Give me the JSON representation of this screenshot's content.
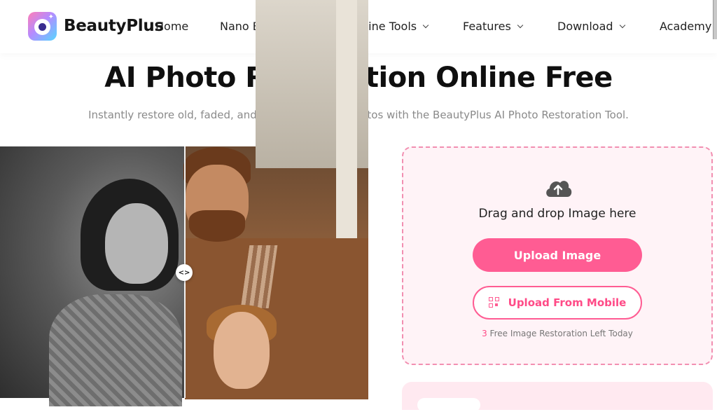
{
  "header": {
    "brand": "BeautyPlus",
    "nav": [
      {
        "label": "Home",
        "dropdown": false
      },
      {
        "label": "Nano Banana Pro",
        "dropdown": false
      },
      {
        "label": "Online Tools",
        "dropdown": true
      },
      {
        "label": "Features",
        "dropdown": true
      },
      {
        "label": "Download",
        "dropdown": true
      },
      {
        "label": "Academy",
        "dropdown": false
      }
    ]
  },
  "hero": {
    "title": "AI Photo Restoration Online Free",
    "subtitle": "Instantly restore old, faded, and black-and-white photos with the BeautyPlus AI Photo Restoration Tool."
  },
  "compare": {
    "handle_glyph": "<>"
  },
  "upload": {
    "drag_text": "Drag and drop Image here",
    "upload_button": "Upload Image",
    "mobile_button": "Upload From Mobile",
    "free_count": "3",
    "free_text": " Free Image Restoration Left Today"
  },
  "colors": {
    "accent": "#ff5c93",
    "panel_bg": "#fff3f7",
    "border_dashed": "#f28fb1"
  },
  "icons": {
    "upload": "cloud-upload-icon",
    "qr": "qr-code-icon",
    "compare_handle": "compare-arrows-icon"
  }
}
